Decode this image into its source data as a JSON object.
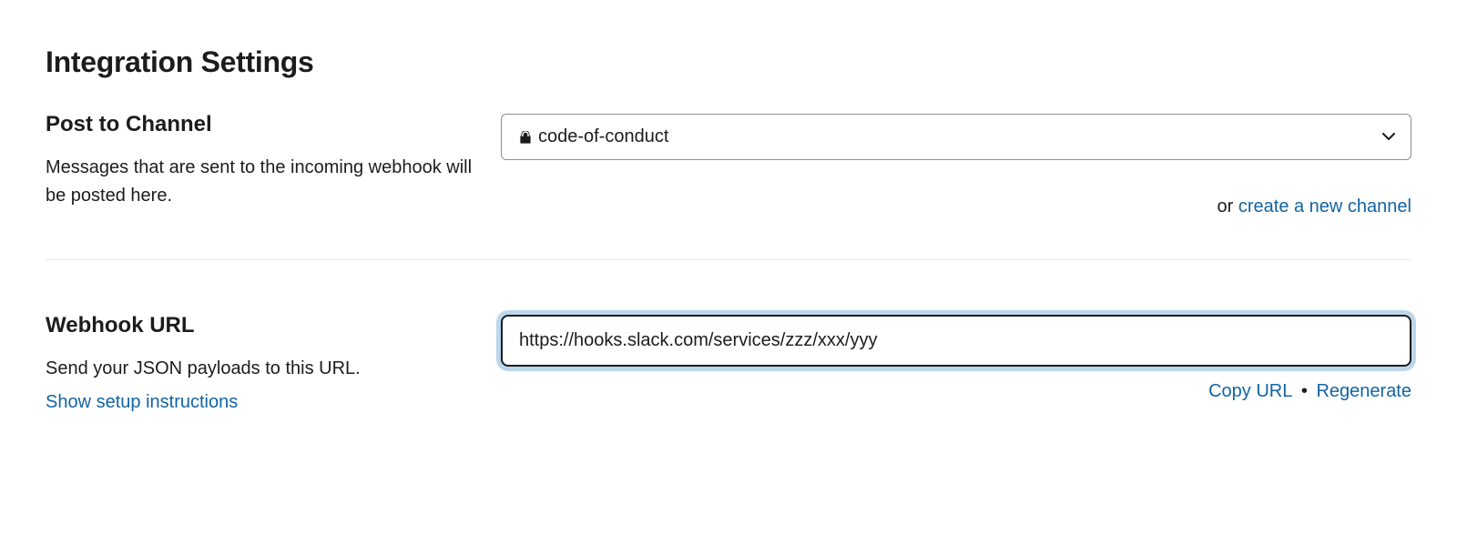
{
  "title": "Integration Settings",
  "post_to_channel": {
    "heading": "Post to Channel",
    "description": "Messages that are sent to the incoming webhook will be posted here.",
    "selected_channel": "code-of-conduct",
    "or_text": "or ",
    "create_link": "create a new channel"
  },
  "webhook_url": {
    "heading": "Webhook URL",
    "description": "Send your JSON payloads to this URL.",
    "show_instructions": "Show setup instructions",
    "url_value": "https://hooks.slack.com/services/zzz/xxx/yyy",
    "copy_label": "Copy URL",
    "separator": " • ",
    "regenerate_label": "Regenerate"
  }
}
